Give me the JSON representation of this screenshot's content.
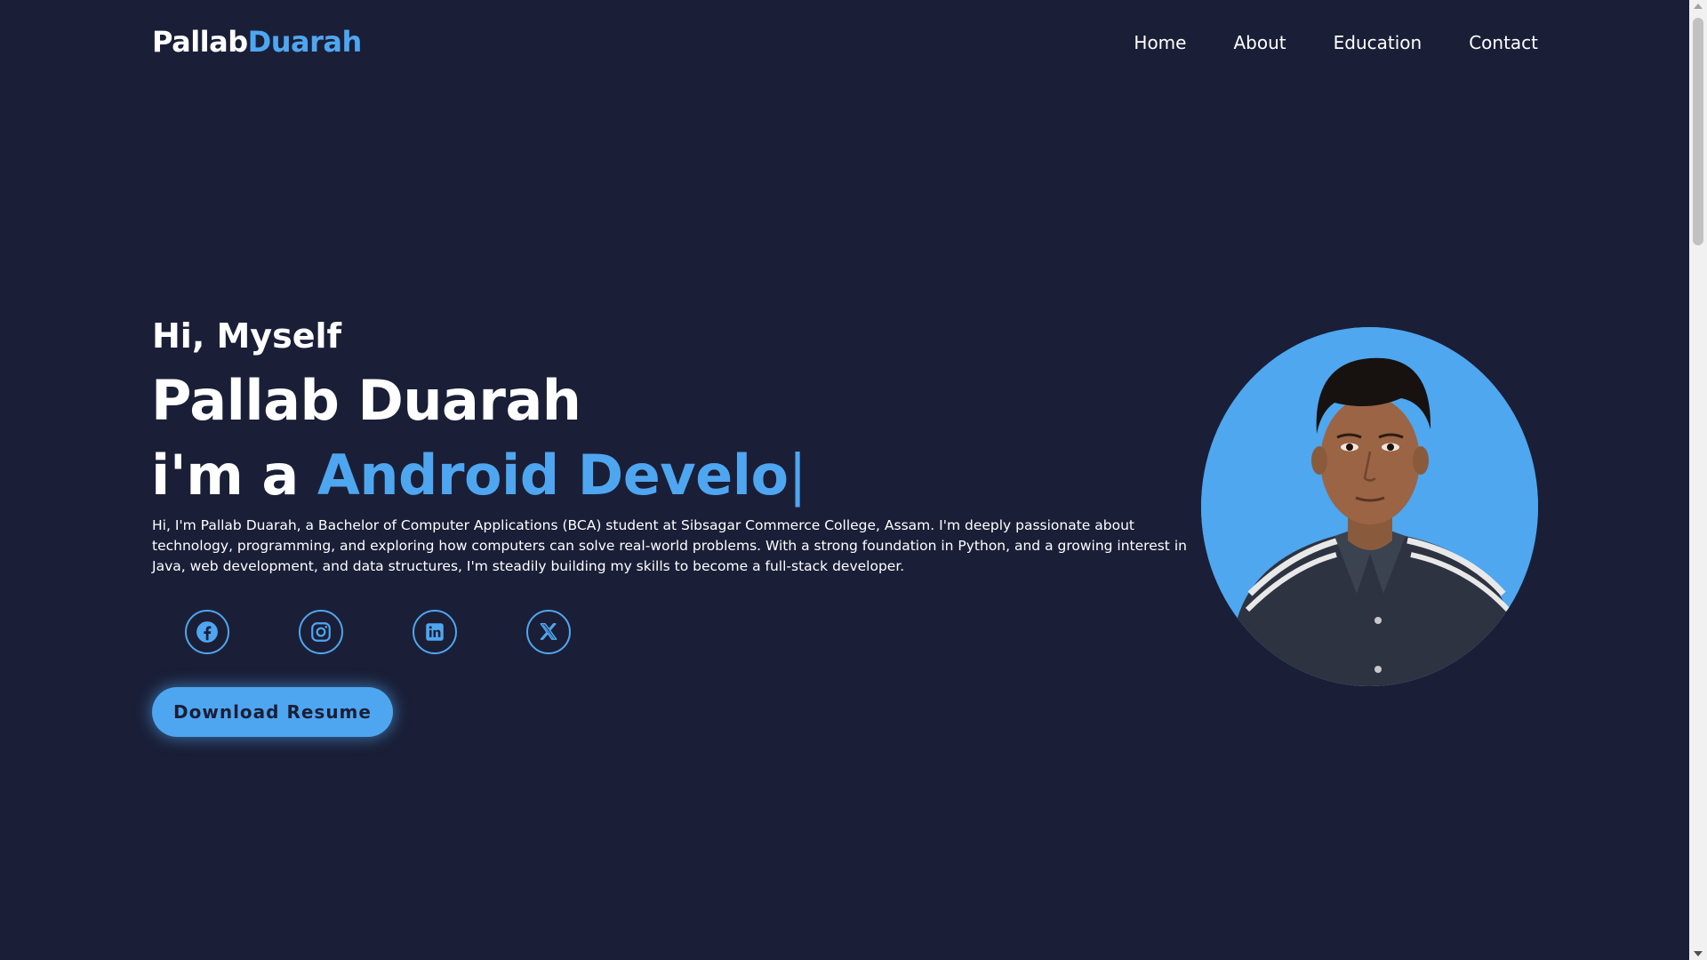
{
  "header": {
    "logo_first": "Pallab",
    "logo_second": "Duarah",
    "nav": [
      {
        "label": "Home"
      },
      {
        "label": "About"
      },
      {
        "label": "Education"
      },
      {
        "label": "Contact"
      }
    ]
  },
  "hero": {
    "greeting": "Hi, Myself",
    "name": "Pallab Duarah",
    "role_prefix": "i'm a ",
    "role_typed": "Android Develo",
    "cursor": "|",
    "description": "Hi, I'm Pallab Duarah, a Bachelor of Computer Applications (BCA) student at Sibsagar Commerce College, Assam. I'm deeply passionate about technology, programming, and exploring how computers can solve real-world problems. With a strong foundation in Python, and a growing interest in Java, web development, and data structures, I'm steadily building my skills to become a full-stack developer.",
    "socials": [
      {
        "icon": "facebook-icon"
      },
      {
        "icon": "instagram-icon"
      },
      {
        "icon": "linkedin-icon"
      },
      {
        "icon": "x-icon"
      }
    ],
    "button_label": "Download Resume",
    "photo_icon": "profile-photo"
  },
  "colors": {
    "background": "#1a1f37",
    "accent": "#4fa6f0",
    "text": "#ffffff"
  }
}
